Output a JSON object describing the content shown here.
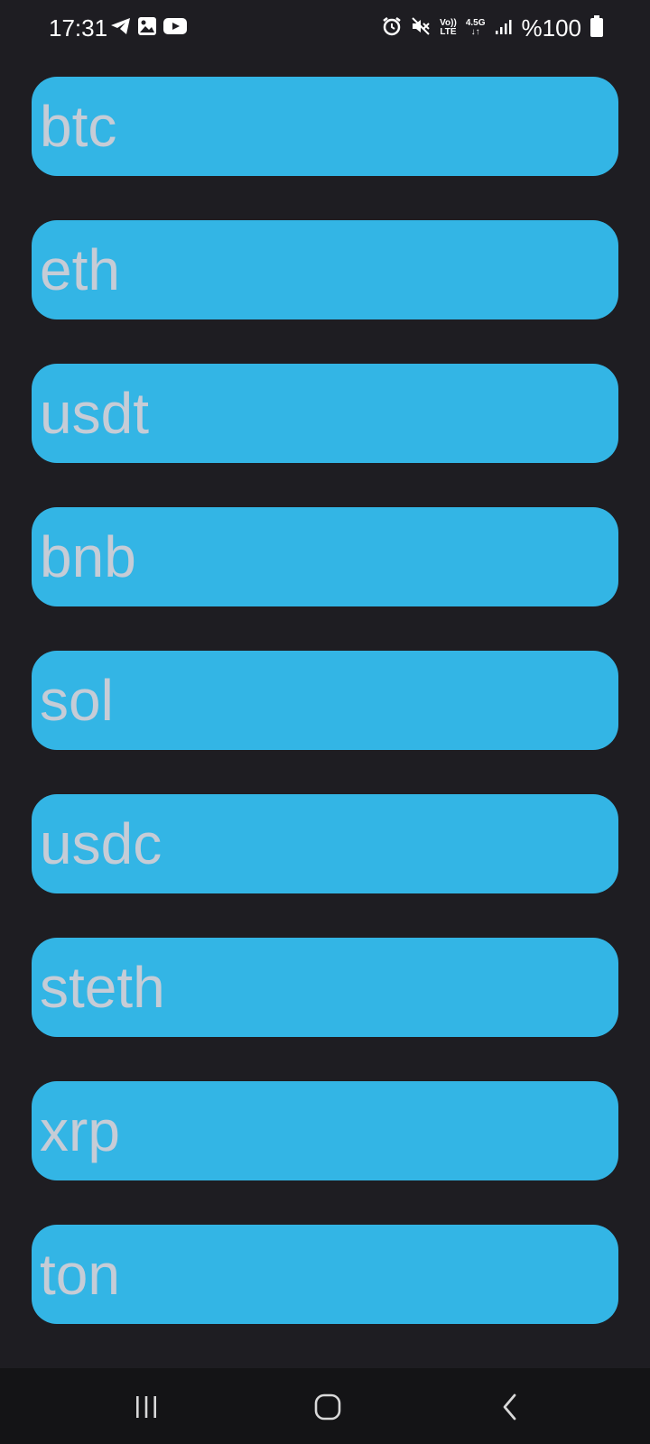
{
  "status_bar": {
    "time": "17:31",
    "left_icons": [
      "telegram-icon",
      "image-icon",
      "youtube-icon"
    ],
    "right_icons": [
      "alarm-icon",
      "mute-icon",
      "volte-icon",
      "network-icon",
      "signal-icon",
      "battery-icon"
    ],
    "volte_top": "Vo))",
    "volte_bottom": "LTE",
    "network_top": "4.5G",
    "network_bottom": "↓↑",
    "battery_text": "%100"
  },
  "coins": [
    {
      "label": "btc"
    },
    {
      "label": "eth"
    },
    {
      "label": "usdt"
    },
    {
      "label": "bnb"
    },
    {
      "label": "sol"
    },
    {
      "label": "usdc"
    },
    {
      "label": "steth"
    },
    {
      "label": "xrp"
    },
    {
      "label": "ton"
    }
  ],
  "colors": {
    "background": "#1e1d22",
    "button": "#33b5e5",
    "button_text": "#c6ccd6",
    "nav_bar": "#141416"
  },
  "nav_bar": {
    "buttons": [
      "recent-apps-icon",
      "home-icon",
      "back-icon"
    ]
  }
}
